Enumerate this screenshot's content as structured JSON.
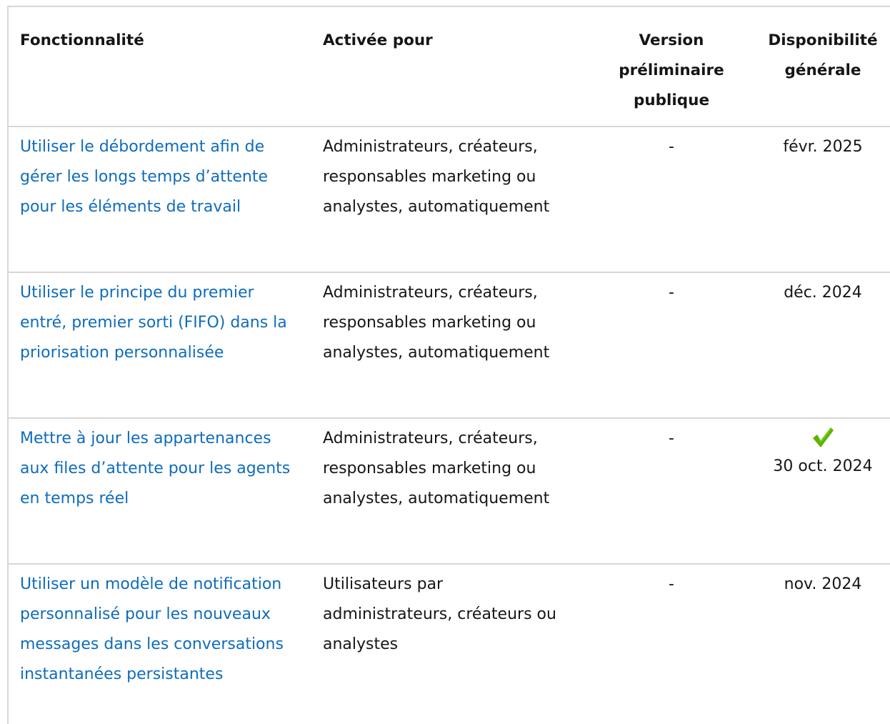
{
  "table": {
    "headers": [
      "Fonctionnalité",
      "Activée pour",
      "Version préliminaire publique",
      "Disponibilité générale"
    ],
    "rows": [
      {
        "feature": "Utiliser le débordement afin de gérer les longs temps d’attente pour les éléments de travail",
        "enabled_for": "Administrateurs, créateurs, responsables marketing ou analystes, automatiquement",
        "preview": "-",
        "ga": "févr. 2025"
      },
      {
        "feature": "Utiliser le principe du premier entré, premier sorti (FIFO) dans la priorisation personnalisée",
        "enabled_for": "Administrateurs, créateurs, responsables marketing ou analystes, automatiquement",
        "preview": "-",
        "ga": "déc. 2024"
      },
      {
        "feature": "Mettre à jour les appartenances aux files d’attente pour les agents en temps réel",
        "enabled_for": "Administrateurs, créateurs, responsables marketing ou analystes, automatiquement",
        "preview": "-",
        "ga": "30 oct. 2024",
        "ga_icon": "checkmark-icon"
      },
      {
        "feature": "Utiliser un modèle de notification personnalisé pour les nouveaux messages dans les conversations instantanées persistantes",
        "enabled_for": "Utilisateurs par administrateurs, créateurs ou analystes",
        "preview": "-",
        "ga": "nov. 2024"
      }
    ]
  },
  "colors": {
    "link": "#0f6cbd",
    "border": "#d7d7d7",
    "check": "#5db300"
  }
}
